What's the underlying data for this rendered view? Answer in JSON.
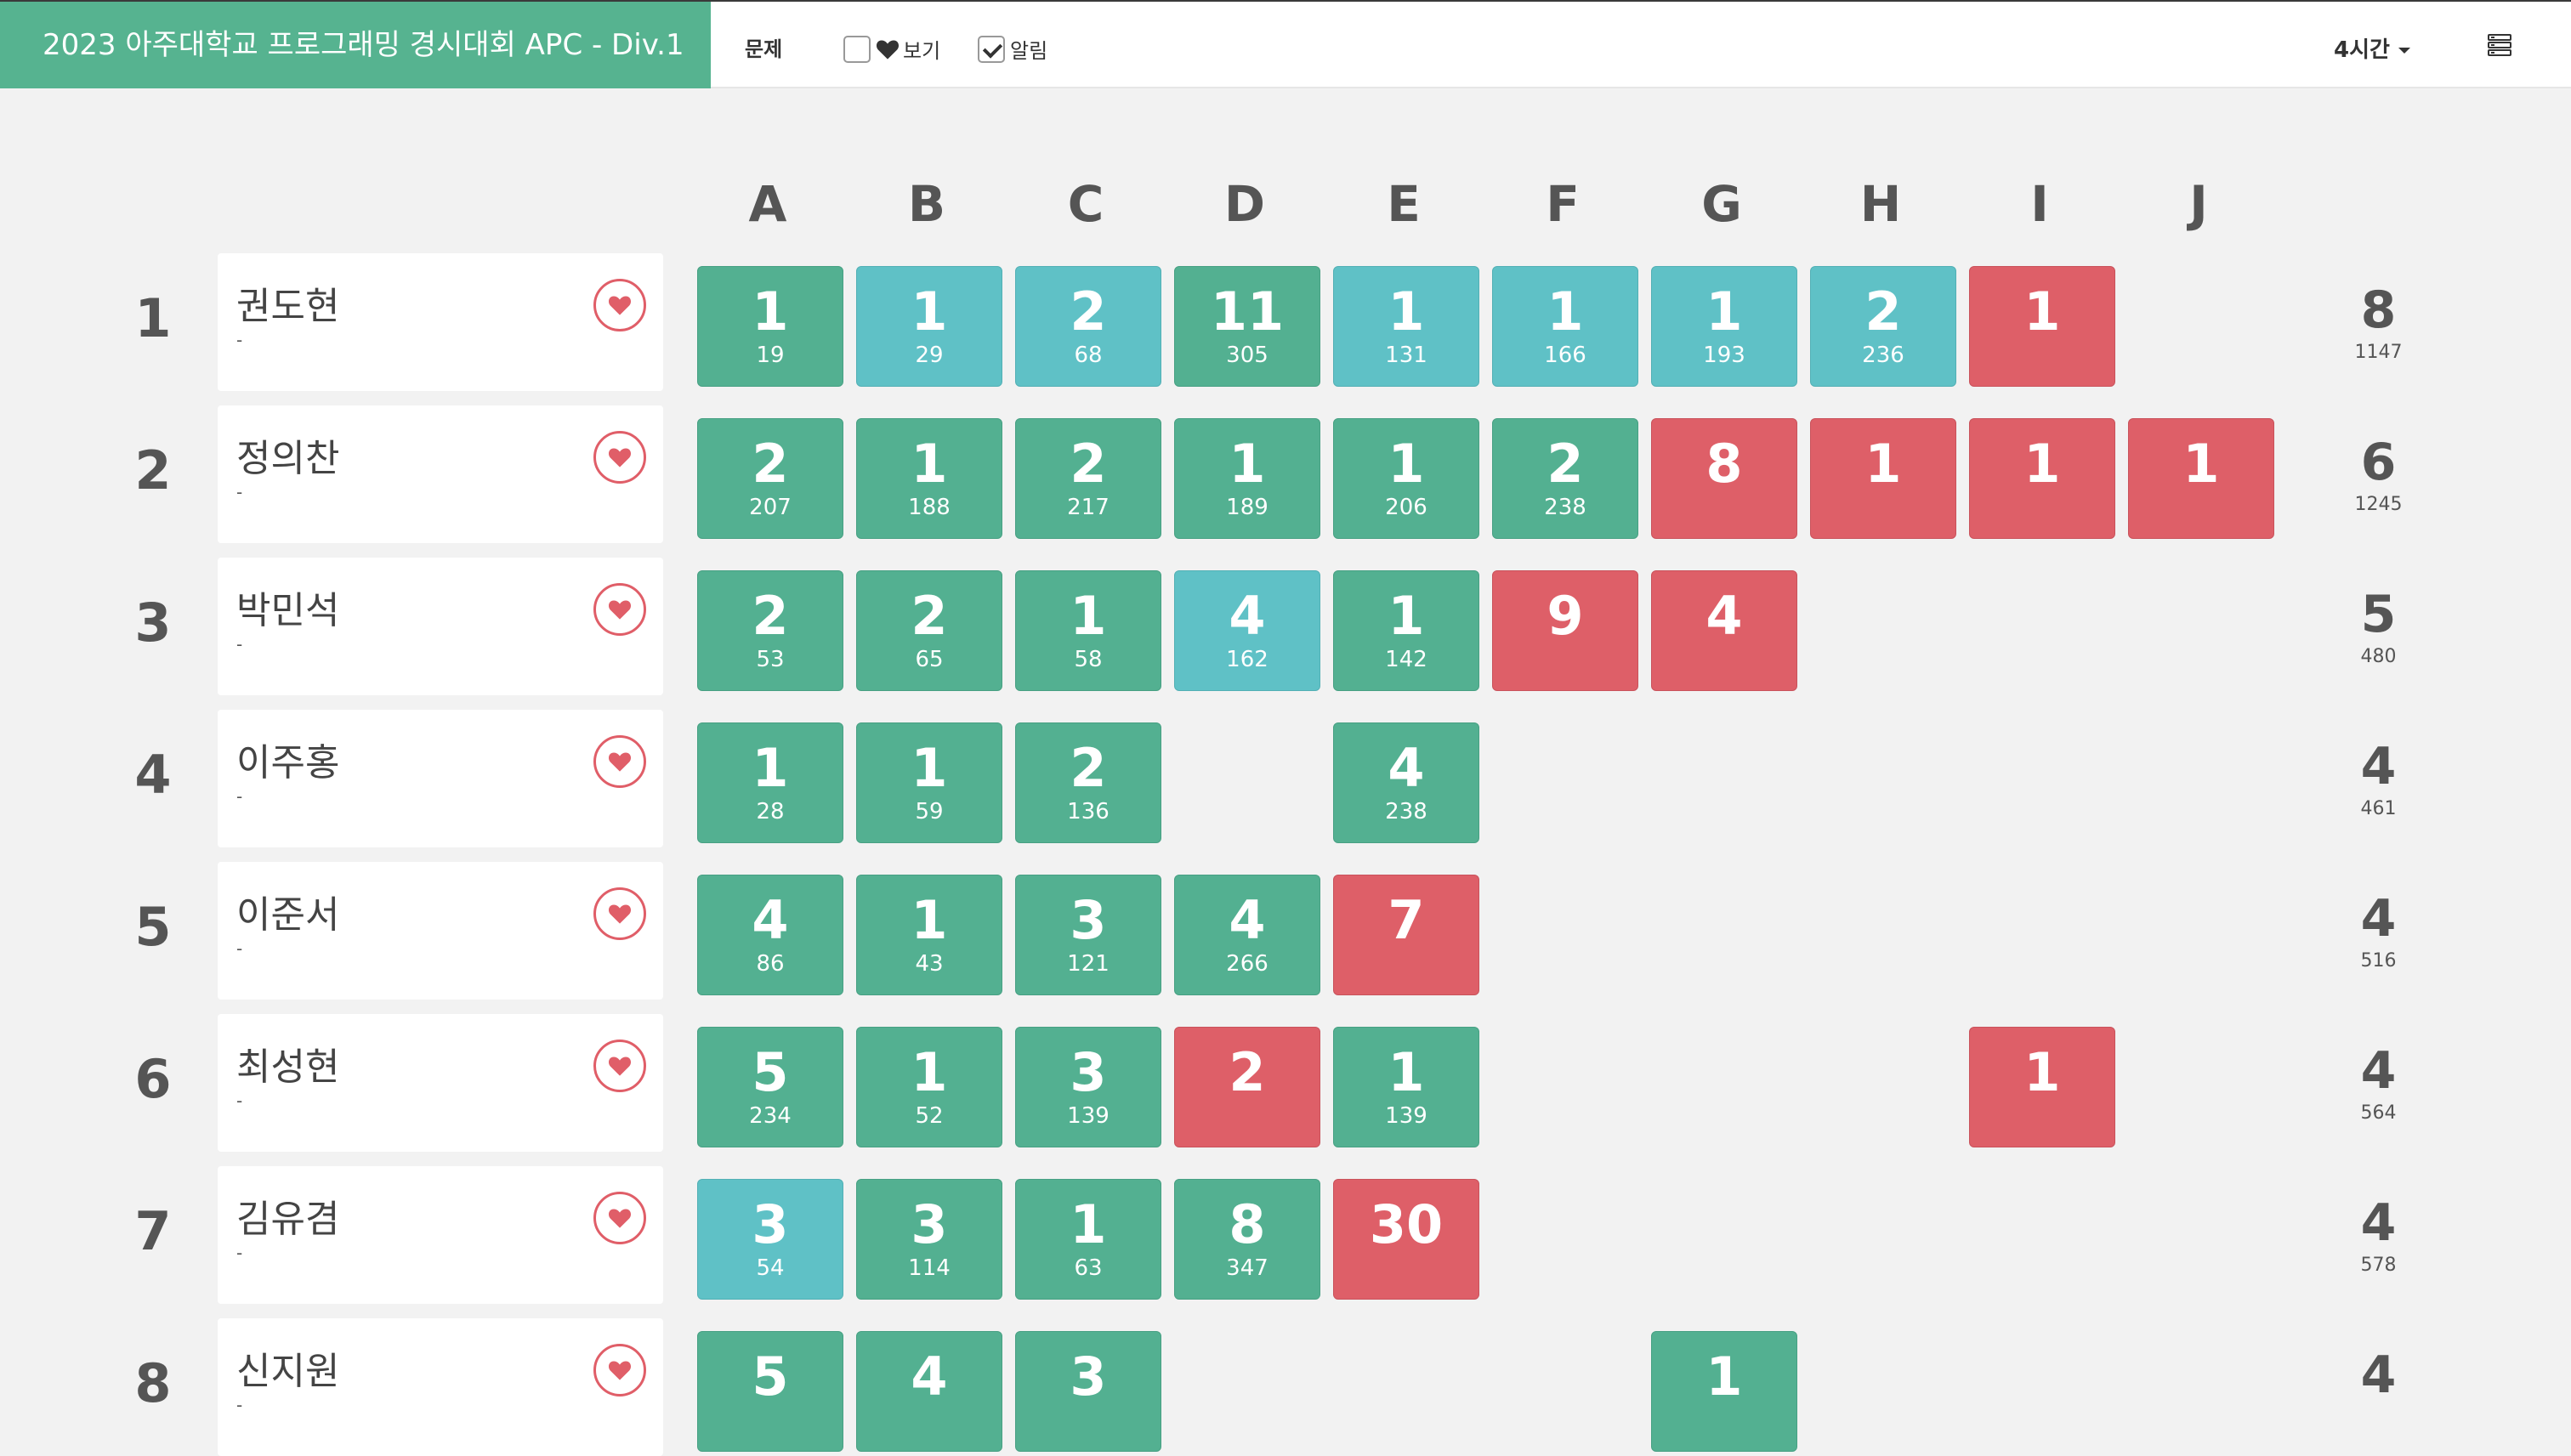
{
  "header": {
    "title": "2023 아주대학교 프로그래밍 경시대회 APC - Div.1",
    "problems_label": "문제",
    "view_label": "보기",
    "view_checked": false,
    "notify_label": "알림",
    "notify_checked": true,
    "time_label": "4시간"
  },
  "colors": {
    "brand": "#56b390",
    "solved": "#53b091",
    "first_solve": "#5fc1c6",
    "failed": "#de5f68",
    "favorite": "#e05e68"
  },
  "problems": [
    "A",
    "B",
    "C",
    "D",
    "E",
    "F",
    "G",
    "H",
    "I",
    "J"
  ],
  "rows": [
    {
      "rank": "1",
      "name": "권도현",
      "affiliation": "-",
      "solved": "8",
      "penalty": "1147",
      "cells": [
        {
          "status": "solved",
          "tries": "1",
          "time": "19"
        },
        {
          "status": "first",
          "tries": "1",
          "time": "29"
        },
        {
          "status": "first",
          "tries": "2",
          "time": "68"
        },
        {
          "status": "solved",
          "tries": "11",
          "time": "305"
        },
        {
          "status": "first",
          "tries": "1",
          "time": "131"
        },
        {
          "status": "first",
          "tries": "1",
          "time": "166"
        },
        {
          "status": "first",
          "tries": "1",
          "time": "193"
        },
        {
          "status": "first",
          "tries": "2",
          "time": "236"
        },
        {
          "status": "fail",
          "tries": "1",
          "time": ""
        },
        null
      ]
    },
    {
      "rank": "2",
      "name": "정의찬",
      "affiliation": "-",
      "solved": "6",
      "penalty": "1245",
      "cells": [
        {
          "status": "solved",
          "tries": "2",
          "time": "207"
        },
        {
          "status": "solved",
          "tries": "1",
          "time": "188"
        },
        {
          "status": "solved",
          "tries": "2",
          "time": "217"
        },
        {
          "status": "solved",
          "tries": "1",
          "time": "189"
        },
        {
          "status": "solved",
          "tries": "1",
          "time": "206"
        },
        {
          "status": "solved",
          "tries": "2",
          "time": "238"
        },
        {
          "status": "fail",
          "tries": "8",
          "time": ""
        },
        {
          "status": "fail",
          "tries": "1",
          "time": ""
        },
        {
          "status": "fail",
          "tries": "1",
          "time": ""
        },
        {
          "status": "fail",
          "tries": "1",
          "time": ""
        }
      ]
    },
    {
      "rank": "3",
      "name": "박민석",
      "affiliation": "-",
      "solved": "5",
      "penalty": "480",
      "cells": [
        {
          "status": "solved",
          "tries": "2",
          "time": "53"
        },
        {
          "status": "solved",
          "tries": "2",
          "time": "65"
        },
        {
          "status": "solved",
          "tries": "1",
          "time": "58"
        },
        {
          "status": "first",
          "tries": "4",
          "time": "162"
        },
        {
          "status": "solved",
          "tries": "1",
          "time": "142"
        },
        {
          "status": "fail",
          "tries": "9",
          "time": ""
        },
        {
          "status": "fail",
          "tries": "4",
          "time": ""
        },
        null,
        null,
        null
      ]
    },
    {
      "rank": "4",
      "name": "이주홍",
      "affiliation": "-",
      "solved": "4",
      "penalty": "461",
      "cells": [
        {
          "status": "solved",
          "tries": "1",
          "time": "28"
        },
        {
          "status": "solved",
          "tries": "1",
          "time": "59"
        },
        {
          "status": "solved",
          "tries": "2",
          "time": "136"
        },
        null,
        {
          "status": "solved",
          "tries": "4",
          "time": "238"
        },
        null,
        null,
        null,
        null,
        null
      ]
    },
    {
      "rank": "5",
      "name": "이준서",
      "affiliation": "-",
      "solved": "4",
      "penalty": "516",
      "cells": [
        {
          "status": "solved",
          "tries": "4",
          "time": "86"
        },
        {
          "status": "solved",
          "tries": "1",
          "time": "43"
        },
        {
          "status": "solved",
          "tries": "3",
          "time": "121"
        },
        {
          "status": "solved",
          "tries": "4",
          "time": "266"
        },
        {
          "status": "fail",
          "tries": "7",
          "time": ""
        },
        null,
        null,
        null,
        null,
        null
      ]
    },
    {
      "rank": "6",
      "name": "최성현",
      "affiliation": "-",
      "solved": "4",
      "penalty": "564",
      "cells": [
        {
          "status": "solved",
          "tries": "5",
          "time": "234"
        },
        {
          "status": "solved",
          "tries": "1",
          "time": "52"
        },
        {
          "status": "solved",
          "tries": "3",
          "time": "139"
        },
        {
          "status": "fail",
          "tries": "2",
          "time": ""
        },
        {
          "status": "solved",
          "tries": "1",
          "time": "139"
        },
        null,
        null,
        null,
        {
          "status": "fail",
          "tries": "1",
          "time": ""
        },
        null
      ]
    },
    {
      "rank": "7",
      "name": "김유겸",
      "affiliation": "-",
      "solved": "4",
      "penalty": "578",
      "cells": [
        {
          "status": "first",
          "tries": "3",
          "time": "54"
        },
        {
          "status": "solved",
          "tries": "3",
          "time": "114"
        },
        {
          "status": "solved",
          "tries": "1",
          "time": "63"
        },
        {
          "status": "solved",
          "tries": "8",
          "time": "347"
        },
        {
          "status": "fail",
          "tries": "30",
          "time": ""
        },
        null,
        null,
        null,
        null,
        null
      ]
    },
    {
      "rank": "8",
      "name": "신지원",
      "affiliation": "-",
      "solved": "4",
      "penalty": "",
      "cells": [
        {
          "status": "solved",
          "tries": "5",
          "time": ""
        },
        {
          "status": "solved",
          "tries": "4",
          "time": ""
        },
        {
          "status": "solved",
          "tries": "3",
          "time": ""
        },
        null,
        null,
        null,
        {
          "status": "solved",
          "tries": "1",
          "time": ""
        },
        null,
        null,
        null
      ]
    }
  ]
}
